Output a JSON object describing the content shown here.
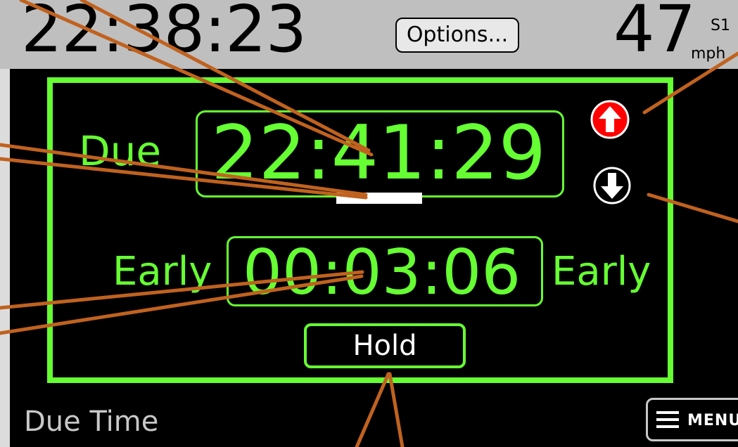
{
  "status_bar": {
    "clock": "22:38:23",
    "options_label": "Options...",
    "speed_value": "47",
    "speed_label": "S1",
    "speed_unit": "mph"
  },
  "due": {
    "label": "Due",
    "time": "22:41:29"
  },
  "schedule": {
    "left_label": "Early",
    "time": "00:03:06",
    "right_label": "Early"
  },
  "controls": {
    "hold_label": "Hold",
    "up_icon": "arrow-up-icon",
    "down_icon": "arrow-down-icon"
  },
  "footer": {
    "screen_title": "Due Time",
    "menu_label": "MENU"
  },
  "colors": {
    "accent": "#66ff33",
    "up_button": "#ff0000",
    "annotation": "#c0621f",
    "status_bar_bg": "#bfbfbf"
  }
}
